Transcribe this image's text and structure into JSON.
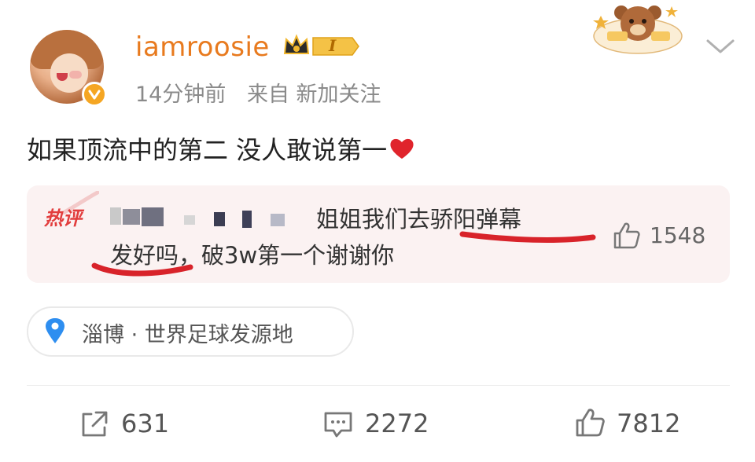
{
  "post": {
    "username": "iamroosie",
    "vip_level": "I",
    "time": "14分钟前",
    "source": "来自 新加关注",
    "text": "如果顶流中的第二 没人敢说第一"
  },
  "hot_comment": {
    "tag": "热评",
    "text_line1": "姐姐我们去骄阳弹幕",
    "text_line2": "发好吗，破3w第一个谢谢你",
    "like_count": "1548"
  },
  "location": {
    "label": "淄博 · 世界足球发源地"
  },
  "actions": {
    "share_count": "631",
    "comment_count": "2272",
    "like_count": "7812"
  },
  "colors": {
    "username": "#e87a1e",
    "hot_tag": "#e23d3d",
    "underline": "#d8232a",
    "location_icon": "#2e8ef0"
  }
}
